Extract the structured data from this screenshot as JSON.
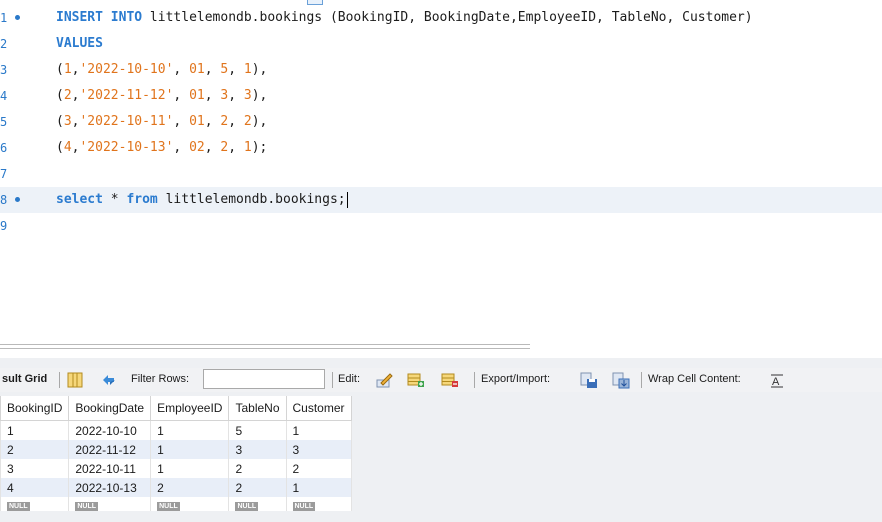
{
  "editor": {
    "lines": [
      {
        "num": "1",
        "marker": true,
        "tokens": [
          {
            "t": "INSERT",
            "c": "kw"
          },
          {
            "t": " ",
            "c": "plain"
          },
          {
            "t": "INTO",
            "c": "kw"
          },
          {
            "t": " littlelemondb.bookings (BookingID, BookingDate,EmployeeID, TableNo, Customer)",
            "c": "plain"
          }
        ]
      },
      {
        "num": "2",
        "marker": false,
        "tokens": [
          {
            "t": "VALUES",
            "c": "kw"
          }
        ]
      },
      {
        "num": "3",
        "marker": false,
        "tokens": [
          {
            "t": "(",
            "c": "plain"
          },
          {
            "t": "1",
            "c": "num"
          },
          {
            "t": ",",
            "c": "plain"
          },
          {
            "t": "'2022-10-10'",
            "c": "str"
          },
          {
            "t": ", ",
            "c": "plain"
          },
          {
            "t": "01",
            "c": "num"
          },
          {
            "t": ", ",
            "c": "plain"
          },
          {
            "t": "5",
            "c": "num"
          },
          {
            "t": ", ",
            "c": "plain"
          },
          {
            "t": "1",
            "c": "num"
          },
          {
            "t": "),",
            "c": "plain"
          }
        ]
      },
      {
        "num": "4",
        "marker": false,
        "tokens": [
          {
            "t": "(",
            "c": "plain"
          },
          {
            "t": "2",
            "c": "num"
          },
          {
            "t": ",",
            "c": "plain"
          },
          {
            "t": "'2022-11-12'",
            "c": "str"
          },
          {
            "t": ", ",
            "c": "plain"
          },
          {
            "t": "01",
            "c": "num"
          },
          {
            "t": ", ",
            "c": "plain"
          },
          {
            "t": "3",
            "c": "num"
          },
          {
            "t": ", ",
            "c": "plain"
          },
          {
            "t": "3",
            "c": "num"
          },
          {
            "t": "),",
            "c": "plain"
          }
        ]
      },
      {
        "num": "5",
        "marker": false,
        "tokens": [
          {
            "t": "(",
            "c": "plain"
          },
          {
            "t": "3",
            "c": "num"
          },
          {
            "t": ",",
            "c": "plain"
          },
          {
            "t": "'2022-10-11'",
            "c": "str"
          },
          {
            "t": ", ",
            "c": "plain"
          },
          {
            "t": "01",
            "c": "num"
          },
          {
            "t": ", ",
            "c": "plain"
          },
          {
            "t": "2",
            "c": "num"
          },
          {
            "t": ", ",
            "c": "plain"
          },
          {
            "t": "2",
            "c": "num"
          },
          {
            "t": "),",
            "c": "plain"
          }
        ]
      },
      {
        "num": "6",
        "marker": false,
        "tokens": [
          {
            "t": "(",
            "c": "plain"
          },
          {
            "t": "4",
            "c": "num"
          },
          {
            "t": ",",
            "c": "plain"
          },
          {
            "t": "'2022-10-13'",
            "c": "str"
          },
          {
            "t": ", ",
            "c": "plain"
          },
          {
            "t": "02",
            "c": "num"
          },
          {
            "t": ", ",
            "c": "plain"
          },
          {
            "t": "2",
            "c": "num"
          },
          {
            "t": ", ",
            "c": "plain"
          },
          {
            "t": "1",
            "c": "num"
          },
          {
            "t": ");",
            "c": "plain"
          }
        ]
      },
      {
        "num": "7",
        "marker": false,
        "tokens": []
      },
      {
        "num": "8",
        "marker": true,
        "current": true,
        "caret": true,
        "tokens": [
          {
            "t": "select",
            "c": "kw"
          },
          {
            "t": " * ",
            "c": "plain"
          },
          {
            "t": "from",
            "c": "kw"
          },
          {
            "t": " littlelemondb.bookings;",
            "c": "plain"
          }
        ]
      },
      {
        "num": "9",
        "marker": false,
        "tokens": []
      }
    ]
  },
  "toolbar": {
    "result_grid_label": "sult Grid",
    "filter_rows_label": "Filter Rows:",
    "filter_value": "",
    "edit_label": "Edit:",
    "export_label": "Export/Import:",
    "wrap_label": "Wrap Cell Content:",
    "icons": [
      "grid-view-icon",
      "refresh-icon",
      "edit-row-icon",
      "add-row-icon",
      "delete-row-icon",
      "export-icon",
      "import-icon",
      "wrap-content-icon"
    ]
  },
  "grid": {
    "columns": [
      "BookingID",
      "BookingDate",
      "EmployeeID",
      "TableNo",
      "Customer"
    ],
    "rows": [
      [
        "1",
        "2022-10-10",
        "1",
        "5",
        "1"
      ],
      [
        "2",
        "2022-11-12",
        "1",
        "3",
        "3"
      ],
      [
        "3",
        "2022-10-11",
        "1",
        "2",
        "2"
      ],
      [
        "4",
        "2022-10-13",
        "2",
        "2",
        "1"
      ]
    ],
    "null_label": "NULL"
  },
  "colors": {
    "keyword": "#2b7bcf",
    "literal": "#e0741c",
    "line_number": "#2a79c9",
    "row_alt": "#e8eef8"
  }
}
